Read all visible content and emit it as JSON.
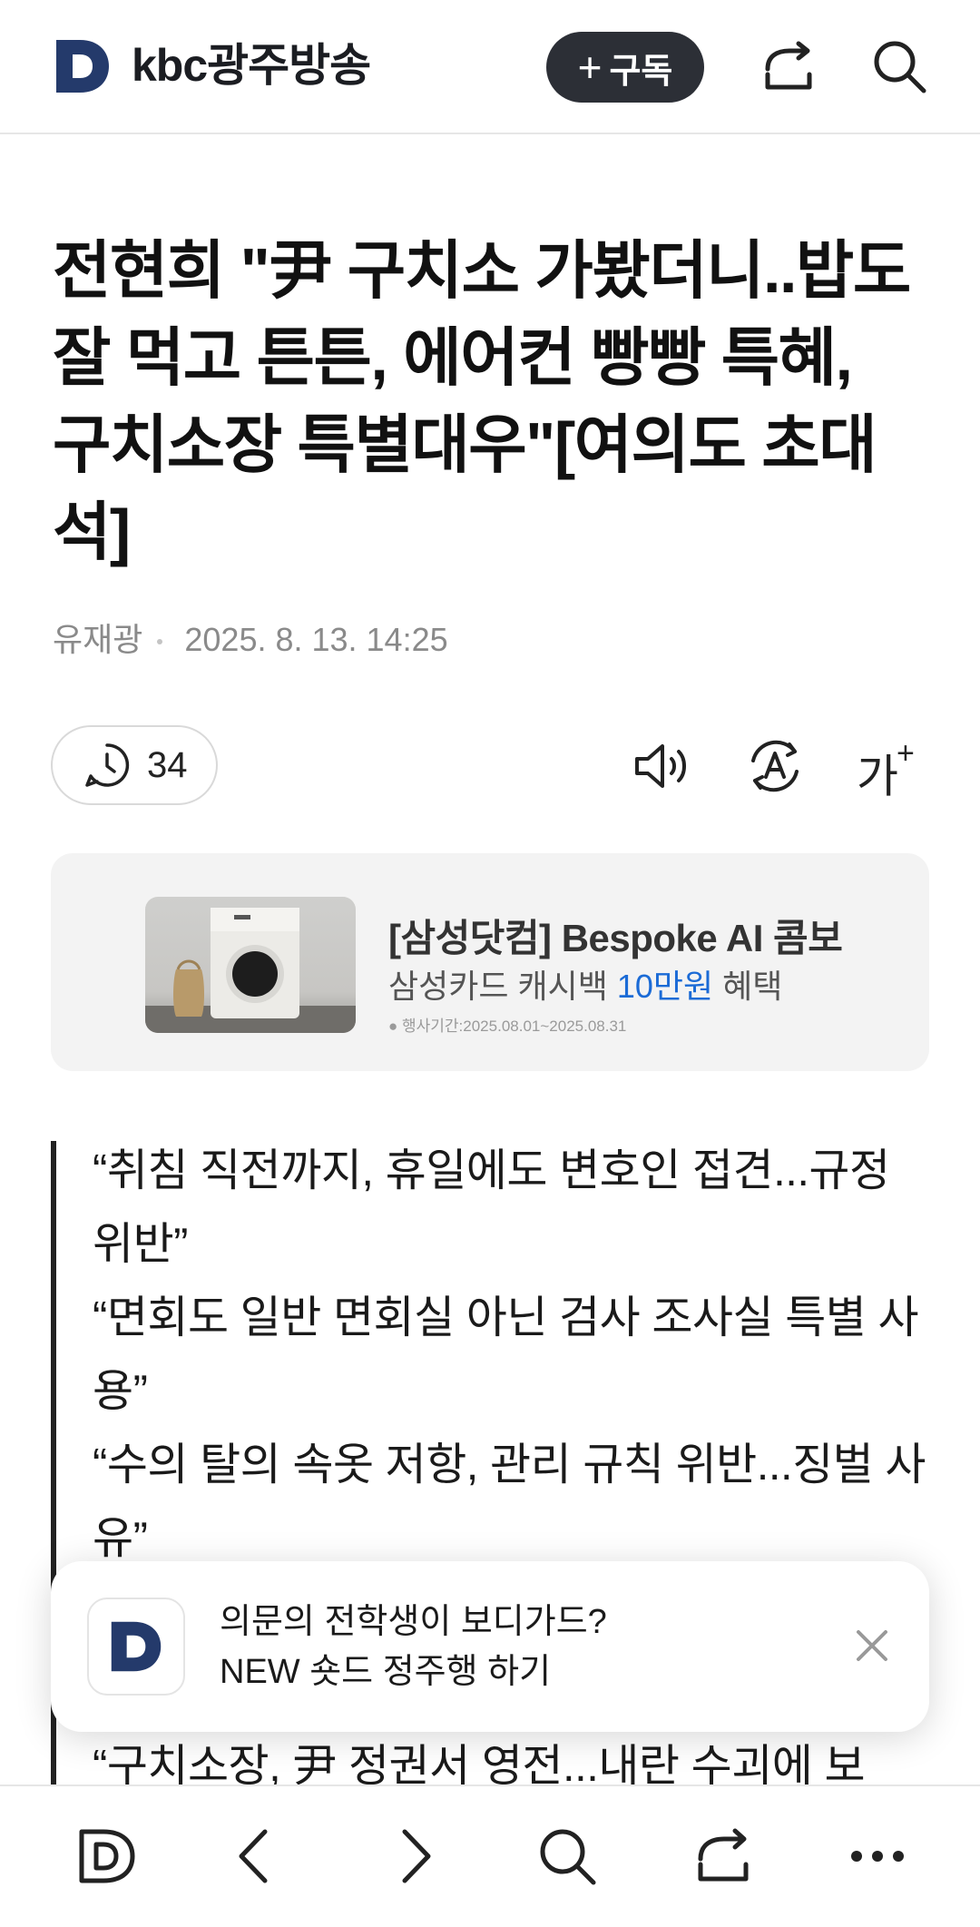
{
  "header": {
    "brand": "kbc광주방송",
    "subscribe_label": "구독",
    "icons": [
      "daum-logo-icon",
      "share-icon",
      "search-icon"
    ]
  },
  "article": {
    "title": "전현희 \"尹 구치소 가봤더니..밥도 잘 먹고 튼튼, 에어컨 빵빵 특혜, 구치소장 특별대우\"[여의도 초대석]",
    "author": "유재광",
    "date": "2025. 8. 13. 14:25"
  },
  "toolbar": {
    "comment_count": "34",
    "font_size_label": "가",
    "font_size_plus": "+",
    "icons": [
      "speaker-icon",
      "translate-icon"
    ]
  },
  "ad": {
    "title": "[삼성닷컴] Bespoke AI 콤보",
    "subtitle_pre": "삼성카드 캐시백 ",
    "subtitle_highlight": "10만원",
    "subtitle_post": " 혜택",
    "period": "● 행사기간:2025.08.01~2025.08.31",
    "highlight_color": "#1b6bd6"
  },
  "quotes": [
    "“취침 직전까지, 휴일에도 변호인 접견...규정 위반”",
    "“면회도 일반 면회실 아닌 검사 조사실 특별 사용”",
    "“수의 탈의 속옷 저항, 관리 규칙 위반...징벌 사유”",
    "“구치소장, 尹 정권서 영전...내란 수괴에 보"
  ],
  "toast": {
    "line1": "의문의 전학생이 보디가드?",
    "line2": "NEW 숏드 정주행 하기"
  },
  "bottom_nav": {
    "icons": [
      "daum-home-icon",
      "back-icon",
      "forward-icon",
      "search-icon",
      "share-icon",
      "more-icon"
    ]
  }
}
